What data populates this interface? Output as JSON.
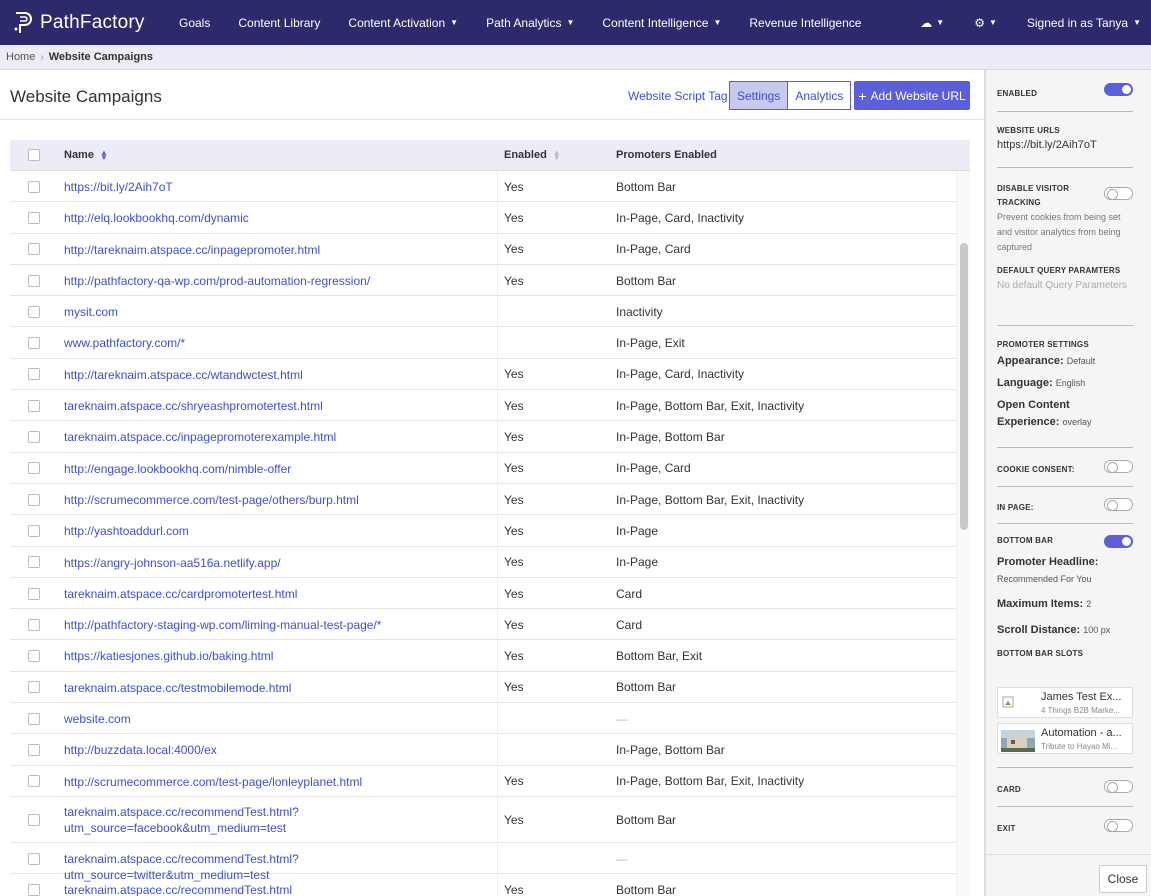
{
  "nav": {
    "brand": "PathFactory",
    "items": [
      {
        "label": "Goals",
        "dropdown": false
      },
      {
        "label": "Content Library",
        "dropdown": false
      },
      {
        "label": "Content Activation",
        "dropdown": true
      },
      {
        "label": "Path Analytics",
        "dropdown": true
      },
      {
        "label": "Content Intelligence",
        "dropdown": true
      },
      {
        "label": "Revenue Intelligence",
        "dropdown": false
      }
    ],
    "signed_in": "Signed in as Tanya",
    "cloud_icon": "cloud-upload-icon",
    "gear_icon": "gear-icon",
    "bg_color": "#2c2a6b"
  },
  "breadcrumb": {
    "home": "Home",
    "current": "Website Campaigns"
  },
  "page": {
    "title": "Website Campaigns",
    "script_tag": "Website Script Tag",
    "settings": "Settings",
    "analytics": "Analytics",
    "add_url": "Add Website URL",
    "accent": "#5b5fd9"
  },
  "table": {
    "headers": {
      "name": "Name",
      "enabled": "Enabled",
      "promoters": "Promoters Enabled"
    },
    "rows": [
      {
        "name": "https://bit.ly/2Aih7oT",
        "enabled": "Yes",
        "promoters": "Bottom Bar"
      },
      {
        "name": "http://elq.lookbookhq.com/dynamic",
        "enabled": "Yes",
        "promoters": "In-Page, Card, Inactivity"
      },
      {
        "name": "http://tareknaim.atspace.cc/inpagepromoter.html",
        "enabled": "Yes",
        "promoters": "In-Page, Card"
      },
      {
        "name": "http://pathfactory-qa-wp.com/prod-automation-regression/",
        "enabled": "Yes",
        "promoters": "Bottom Bar"
      },
      {
        "name": "mysit.com",
        "enabled": "",
        "promoters": "Inactivity"
      },
      {
        "name": "www.pathfactory.com/*",
        "enabled": "",
        "promoters": "In-Page, Exit"
      },
      {
        "name": "http://tareknaim.atspace.cc/wtandwctest.html",
        "enabled": "Yes",
        "promoters": "In-Page, Card, Inactivity"
      },
      {
        "name": "tareknaim.atspace.cc/shryeashpromotertest.html",
        "enabled": "Yes",
        "promoters": "In-Page, Bottom Bar, Exit, Inactivity"
      },
      {
        "name": "tareknaim.atspace.cc/inpagepromoterexample.html",
        "enabled": "Yes",
        "promoters": "In-Page, Bottom Bar"
      },
      {
        "name": "http://engage.lookbookhq.com/nimble-offer",
        "enabled": "Yes",
        "promoters": "In-Page, Card"
      },
      {
        "name": "http://scrumecommerce.com/test-page/others/burp.html",
        "enabled": "Yes",
        "promoters": "In-Page, Bottom Bar, Exit, Inactivity"
      },
      {
        "name": "http://yashtoaddurl.com",
        "enabled": "Yes",
        "promoters": "In-Page"
      },
      {
        "name": "https://angry-johnson-aa516a.netlify.app/",
        "enabled": "Yes",
        "promoters": "In-Page"
      },
      {
        "name": "tareknaim.atspace.cc/cardpromotertest.html",
        "enabled": "Yes",
        "promoters": "Card"
      },
      {
        "name": "http://pathfactory-staging-wp.com/liming-manual-test-page/*",
        "enabled": "Yes",
        "promoters": "Card"
      },
      {
        "name": "https://katiesjones.github.io/baking.html",
        "enabled": "Yes",
        "promoters": "Bottom Bar, Exit"
      },
      {
        "name": "tareknaim.atspace.cc/testmobilemode.html",
        "enabled": "Yes",
        "promoters": "Bottom Bar"
      },
      {
        "name": "website.com",
        "enabled": "",
        "promoters": "—"
      },
      {
        "name": "http://buzzdata.local:4000/ex",
        "enabled": "",
        "promoters": "In-Page, Bottom Bar"
      },
      {
        "name": "http://scrumecommerce.com/test-page/lonleyplanet.html",
        "enabled": "Yes",
        "promoters": "In-Page, Bottom Bar, Exit, Inactivity"
      },
      {
        "name": "tareknaim.atspace.cc/recommendTest.html?utm_source=facebook&utm_medium=test",
        "enabled": "Yes",
        "promoters": "Bottom Bar"
      },
      {
        "name": "tareknaim.atspace.cc/recommendTest.html?utm_source=twitter&utm_medium=test",
        "enabled": "",
        "promoters": "—"
      },
      {
        "name": "tareknaim.atspace.cc/recommendTest.html",
        "enabled": "Yes",
        "promoters": "Bottom Bar"
      }
    ]
  },
  "panel": {
    "enabled_label": "ENABLED",
    "enabled": true,
    "urls_label": "WEBSITE URLS",
    "url": "https://bit.ly/2Aih7oT",
    "disable_tracking_label": "DISABLE VISITOR TRACKING",
    "disable_tracking": false,
    "disable_tracking_desc": "Prevent cookies from being set and visitor analytics from being captured",
    "query_label": "DEFAULT QUERY PARAMTERS",
    "query_value": "No default Query Parameters",
    "promoter_settings_label": "PROMOTER SETTINGS",
    "appearance_key": "Appearance:",
    "appearance_val": "Default",
    "language_key": "Language:",
    "language_val": "English",
    "oce_key": "Open Content Experience:",
    "oce_val": "overlay",
    "cookie_label": "COOKIE CONSENT:",
    "cookie": false,
    "inpage_label": "IN PAGE:",
    "inpage": false,
    "bottombar_label": "BOTTOM BAR",
    "bottombar": true,
    "headline_key": "Promoter Headline:",
    "headline_val": "Recommended For You",
    "maxitems_key": "Maximum Items:",
    "maxitems_val": "2",
    "scroll_key": "Scroll Distance:",
    "scroll_val": "100 px",
    "slots_label": "BOTTOM BAR SLOTS",
    "slots": [
      {
        "title": "James Test Ex...",
        "subtitle": "4 Things B2B Marke..."
      },
      {
        "title": "Automation - a...",
        "subtitle": "Tribute to Hayao Mi..."
      }
    ],
    "card_label": "CARD",
    "card": false,
    "exit_label": "EXIT",
    "exit": false,
    "close": "Close"
  }
}
